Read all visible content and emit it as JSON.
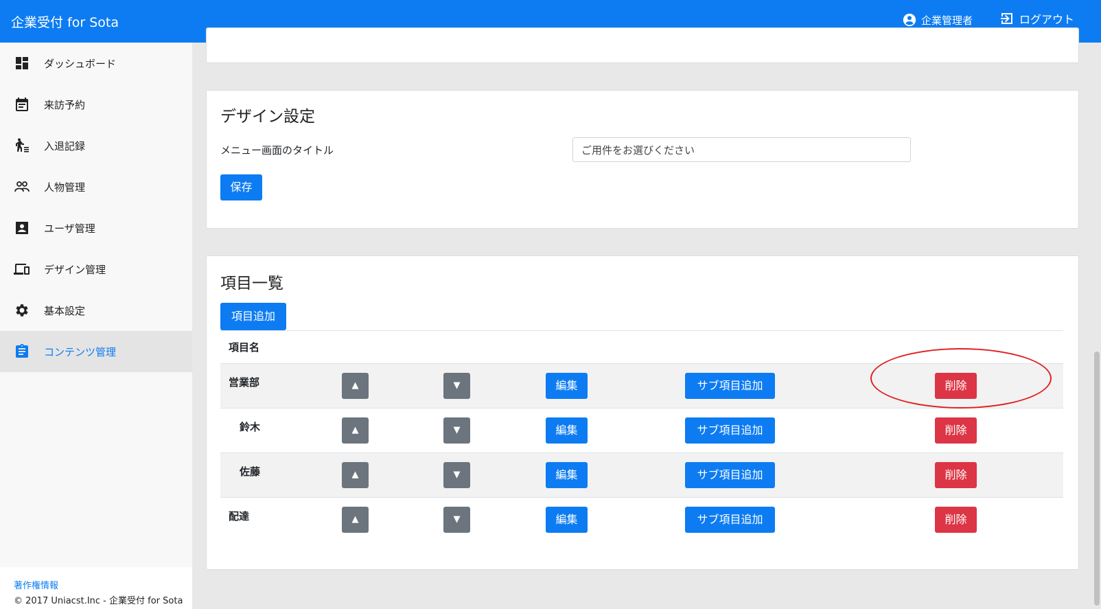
{
  "header": {
    "brand": "企業受付 for Sota",
    "user_label": "企業管理者",
    "logout_label": "ログアウト"
  },
  "sidebar": {
    "items": [
      {
        "label": "ダッシュボード",
        "icon": "dashboard-icon"
      },
      {
        "label": "来訪予約",
        "icon": "calendar-icon"
      },
      {
        "label": "入退記録",
        "icon": "walking-person-icon"
      },
      {
        "label": "人物管理",
        "icon": "people-icon"
      },
      {
        "label": "ユーザ管理",
        "icon": "account-box-icon"
      },
      {
        "label": "デザイン管理",
        "icon": "devices-icon"
      },
      {
        "label": "基本設定",
        "icon": "gear-icon"
      },
      {
        "label": "コンテンツ管理",
        "icon": "clipboard-icon",
        "active": true
      }
    ],
    "footer": {
      "copyright_link": "著作権情報",
      "copyright_text": "© 2017 Uniacst.Inc - 企業受付 for Sota"
    }
  },
  "design_settings": {
    "title": "デザイン設定",
    "menu_title_label": "メニュー画面のタイトル",
    "menu_title_value": "ご用件をお選びください",
    "save_label": "保存"
  },
  "item_list": {
    "title": "項目一覧",
    "add_label": "項目追加",
    "column_header": "項目名",
    "up_label": "▲",
    "down_label": "▼",
    "edit_label": "編集",
    "add_sub_label": "サブ項目追加",
    "delete_label": "削除",
    "rows": [
      {
        "name": "営業部",
        "level": 0
      },
      {
        "name": "鈴木",
        "level": 1
      },
      {
        "name": "佐藤",
        "level": 1
      },
      {
        "name": "配達",
        "level": 0
      }
    ]
  },
  "colors": {
    "primary": "#0d7cf2",
    "secondary": "#6c757d",
    "danger": "#dc3545",
    "annotation": "#e02020"
  }
}
